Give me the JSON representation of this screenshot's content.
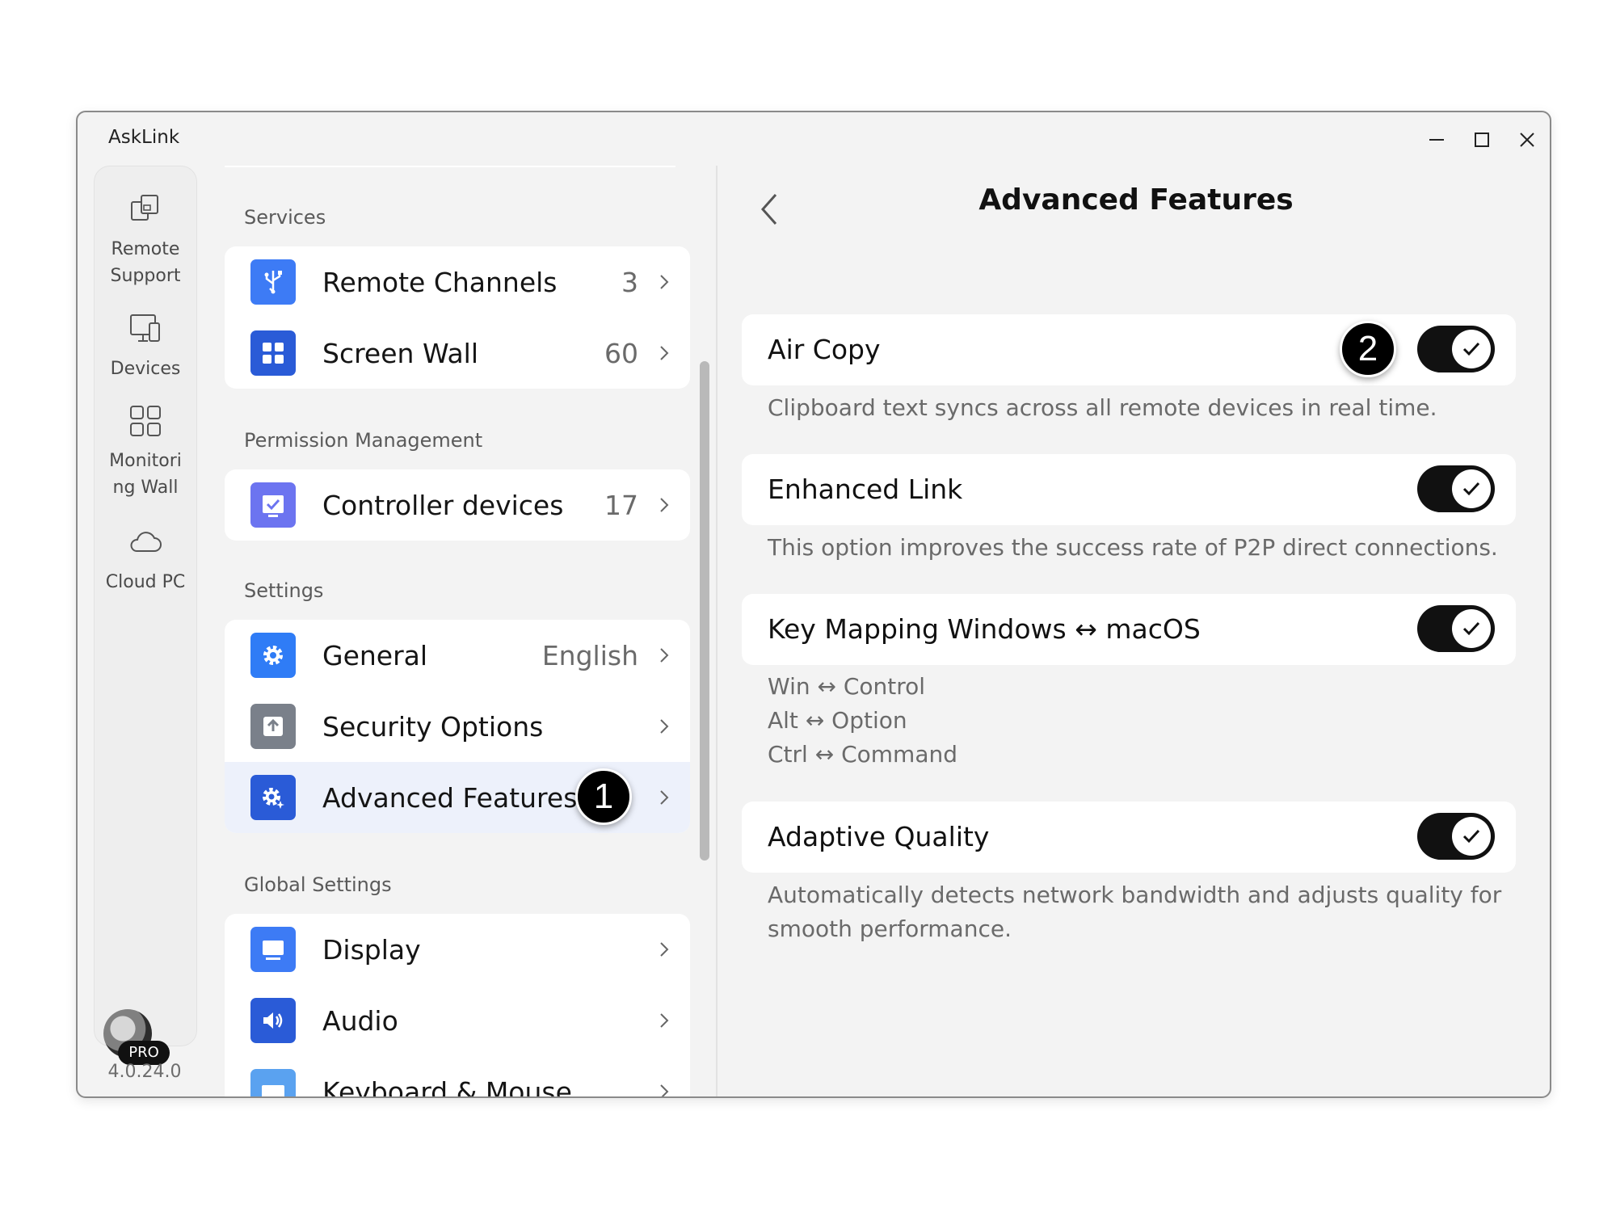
{
  "app": {
    "title": "AskLink",
    "version": "4.0.24.0",
    "pro_badge": "PRO"
  },
  "rail": {
    "items": [
      {
        "label": "Remote Support",
        "icon": "remote-support-icon"
      },
      {
        "label": "Devices",
        "icon": "devices-icon"
      },
      {
        "label": "Monitoring Wall",
        "icon": "monitoring-wall-icon"
      },
      {
        "label": "Cloud PC",
        "icon": "cloud-icon"
      }
    ]
  },
  "sections": {
    "services": {
      "title": "Services",
      "items": [
        {
          "label": "Remote Channels",
          "value": "3",
          "icon": "usb-icon",
          "color": "#3d7bf5"
        },
        {
          "label": "Screen Wall",
          "value": "60",
          "icon": "grid-icon",
          "color": "#2a5bd7"
        }
      ]
    },
    "permission": {
      "title": "Permission Management",
      "items": [
        {
          "label": "Controller devices",
          "value": "17",
          "icon": "checked-monitor-icon",
          "color": "#6c74f0"
        }
      ]
    },
    "settings": {
      "title": "Settings",
      "items": [
        {
          "label": "General",
          "value": "English",
          "icon": "gear-icon",
          "color": "#2f7cf6"
        },
        {
          "label": "Security Options",
          "value": "",
          "icon": "shield-upload-icon",
          "color": "#7a808a"
        },
        {
          "label": "Advanced Features",
          "value": "",
          "icon": "advanced-gear-icon",
          "color": "#2a5bd7"
        }
      ]
    },
    "global": {
      "title": "Global Settings",
      "items": [
        {
          "label": "Display",
          "icon": "display-icon",
          "color": "#3d7bf5"
        },
        {
          "label": "Audio",
          "icon": "speaker-icon",
          "color": "#2a5bd7"
        },
        {
          "label": "Keyboard & Mouse",
          "icon": "keyboard-icon",
          "color": "#5aa2f0"
        }
      ]
    }
  },
  "annotations": {
    "one": "1",
    "two": "2"
  },
  "detail": {
    "title": "Advanced Features",
    "features": [
      {
        "name": "Air Copy",
        "enabled": true,
        "desc": [
          "Clipboard text syncs across all remote devices in real time."
        ]
      },
      {
        "name": "Enhanced Link",
        "enabled": true,
        "desc": [
          "This option improves the success rate of P2P direct connections."
        ]
      },
      {
        "name": "Key Mapping Windows ↔ macOS",
        "enabled": true,
        "desc": [
          "Win ↔ Control",
          "Alt ↔ Option",
          "Ctrl ↔ Command"
        ]
      },
      {
        "name": "Adaptive Quality",
        "enabled": true,
        "desc": [
          "Automatically detects network bandwidth and adjusts quality for",
          "smooth performance."
        ]
      }
    ]
  }
}
